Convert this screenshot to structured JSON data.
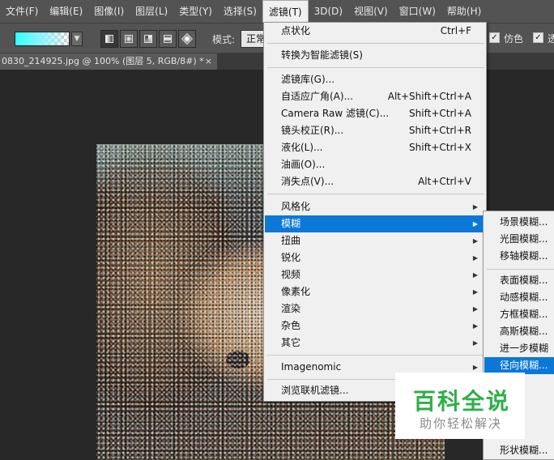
{
  "menubar": {
    "items": [
      {
        "label": "文件(F)"
      },
      {
        "label": "编辑(E)"
      },
      {
        "label": "图像(I)"
      },
      {
        "label": "图层(L)"
      },
      {
        "label": "类型(Y)"
      },
      {
        "label": "选择(S)"
      },
      {
        "label": "滤镜(T)",
        "active": true
      },
      {
        "label": "3D(D)"
      },
      {
        "label": "视图(V)"
      },
      {
        "label": "窗口(W)"
      },
      {
        "label": "帮助(H)"
      }
    ]
  },
  "options": {
    "mode_label": "模式:",
    "mode_value": "正常",
    "dither_label": "仿色",
    "transparency_label": "透",
    "gradient_colors": [
      "#33ffff",
      "#88f4ff"
    ]
  },
  "document_tab": {
    "title": "0830_214925.jpg @ 100% (图层 5, RGB/8#) *",
    "close": "×"
  },
  "filter_menu": {
    "items": [
      {
        "label": "点状化",
        "shortcut": "Ctrl+F"
      },
      {
        "label": "转换为智能滤镜(S)",
        "shortcut": ""
      },
      {
        "label": "滤镜库(G)...",
        "shortcut": ""
      },
      {
        "label": "自适应广角(A)...",
        "shortcut": "Alt+Shift+Ctrl+A"
      },
      {
        "label": "Camera Raw 滤镜(C)...",
        "shortcut": "Shift+Ctrl+A"
      },
      {
        "label": "镜头校正(R)...",
        "shortcut": "Shift+Ctrl+R"
      },
      {
        "label": "液化(L)...",
        "shortcut": "Shift+Ctrl+X"
      },
      {
        "label": "油画(O)...",
        "shortcut": ""
      },
      {
        "label": "消失点(V)...",
        "shortcut": "Alt+Ctrl+V"
      },
      {
        "label": "风格化",
        "submenu": true
      },
      {
        "label": "模糊",
        "submenu": true,
        "highlighted": true
      },
      {
        "label": "扭曲",
        "submenu": true
      },
      {
        "label": "锐化",
        "submenu": true
      },
      {
        "label": "视频",
        "submenu": true
      },
      {
        "label": "像素化",
        "submenu": true
      },
      {
        "label": "渲染",
        "submenu": true
      },
      {
        "label": "杂色",
        "submenu": true
      },
      {
        "label": "其它",
        "submenu": true
      },
      {
        "label": "Imagenomic",
        "submenu": true
      },
      {
        "label": "浏览联机滤镜...",
        "shortcut": ""
      }
    ]
  },
  "blur_submenu": {
    "items": [
      {
        "label": "场景模糊..."
      },
      {
        "label": "光圈模糊..."
      },
      {
        "label": "移轴模糊..."
      },
      {
        "label": "表面模糊..."
      },
      {
        "label": "动感模糊..."
      },
      {
        "label": "方框模糊..."
      },
      {
        "label": "高斯模糊..."
      },
      {
        "label": "进一步模糊"
      },
      {
        "label": "径向模糊...",
        "highlighted": true
      },
      {
        "label": "形状模糊..."
      }
    ]
  },
  "watermark": {
    "title": "百科全说",
    "subtitle": "助你轻松解决"
  },
  "colors": {
    "highlight": "#0b78d7",
    "menu_bg": "#f0f0f0",
    "chrome": "#535353"
  }
}
